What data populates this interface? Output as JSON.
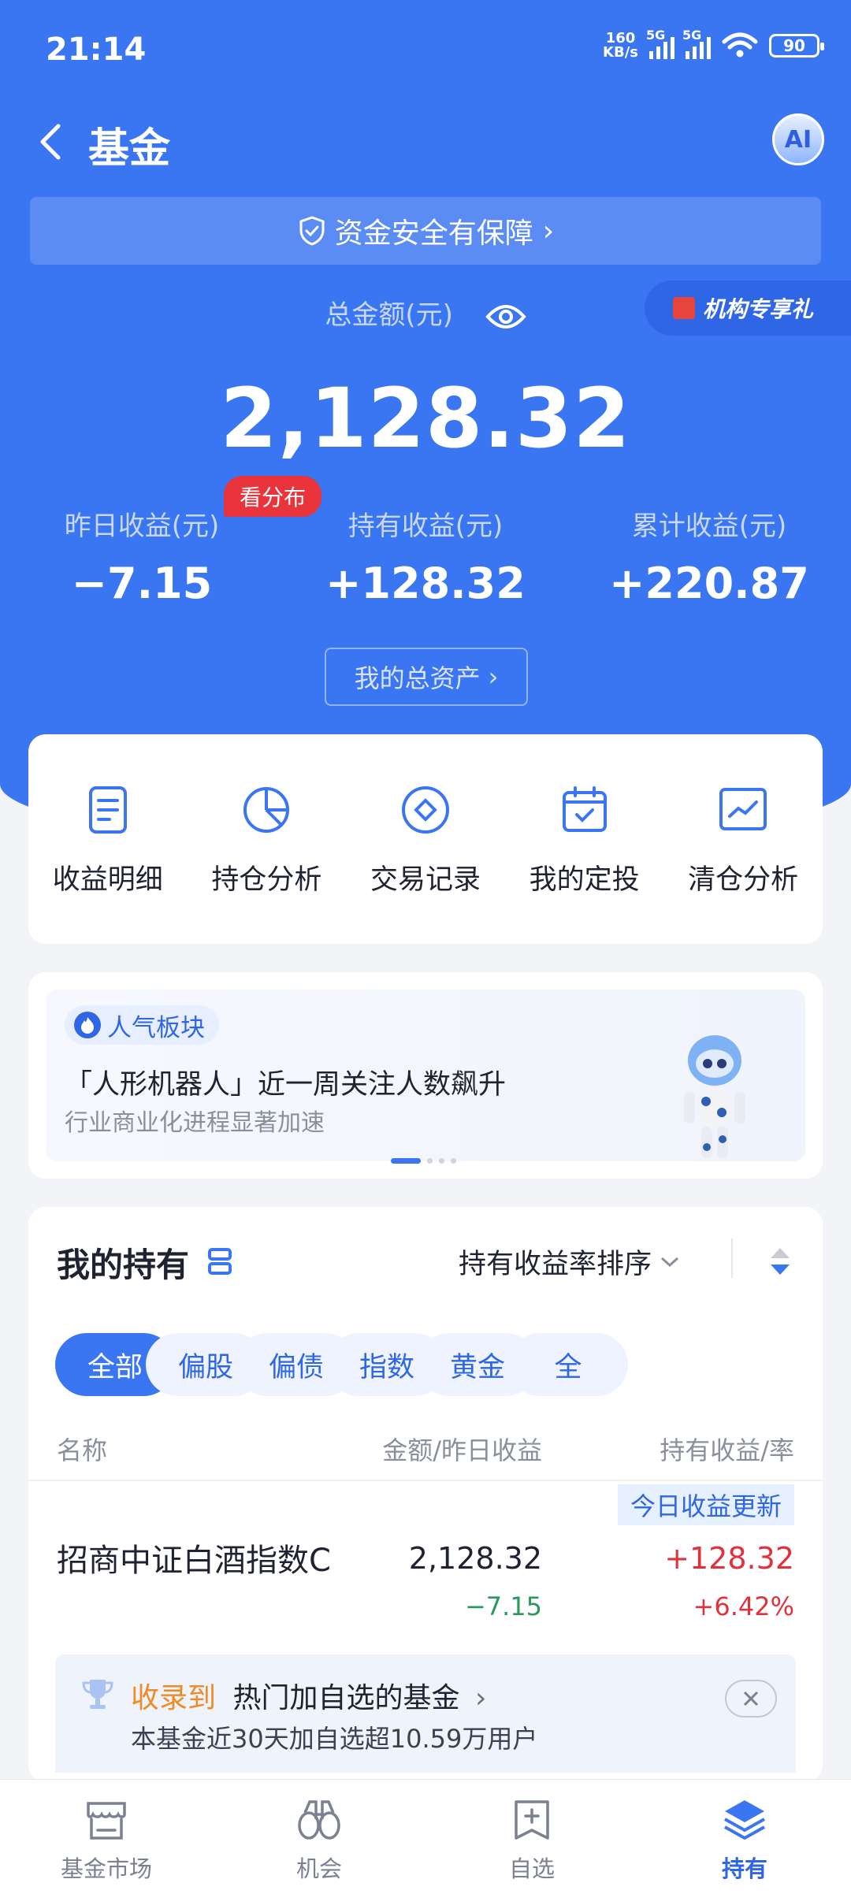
{
  "status_bar": {
    "time": "21:14",
    "net_speed_value": "160",
    "net_speed_unit": "KB/s",
    "signal1_label": "5G",
    "signal2_label": "5G",
    "battery": "90"
  },
  "header": {
    "title": "基金",
    "ai_label": "AI"
  },
  "safety_banner": {
    "text": "资金安全有保障",
    "arrow": "›"
  },
  "institution_badge": {
    "text": "机构专享礼"
  },
  "summary": {
    "total_label": "总金额(元)",
    "total_value": "2,128.32",
    "distribution_badge": "看分布",
    "stats": [
      {
        "label": "昨日收益(元)",
        "value": "−7.15"
      },
      {
        "label": "持有收益(元)",
        "value": "+128.32"
      },
      {
        "label": "累计收益(元)",
        "value": "+220.87"
      }
    ],
    "assets_button": "我的总资产",
    "assets_arrow": "›"
  },
  "tools": [
    {
      "label": "收益明细",
      "icon": "document-icon"
    },
    {
      "label": "持仓分析",
      "icon": "pie-chart-icon"
    },
    {
      "label": "交易记录",
      "icon": "diamond-record-icon"
    },
    {
      "label": "我的定投",
      "icon": "calendar-check-icon"
    },
    {
      "label": "清仓分析",
      "icon": "trend-chart-icon"
    }
  ],
  "promo": {
    "tag": "人气板块",
    "headline": "「人形机器人」近一周关注人数飙升",
    "subtitle": "行业商业化进程显著加速"
  },
  "holdings": {
    "title": "我的持有",
    "sort_label": "持有收益率排序",
    "filters": [
      "全部",
      "偏股",
      "偏债",
      "指数",
      "黄金",
      "全"
    ],
    "columns": {
      "name": "名称",
      "amount": "金额/昨日收益",
      "profit": "持有收益/率"
    },
    "update_badge": "今日收益更新",
    "fund": {
      "name": "招商中证白酒指数C",
      "amount": "2,128.32",
      "yesterday": "−7.15",
      "hold_profit": "+128.32",
      "hold_rate": "+6.42%"
    },
    "recommend": {
      "prefix": "收录到",
      "title": "热门加自选的基金",
      "arrow": "›",
      "detail": "本基金近30天加自选超10.59万用户"
    }
  },
  "tabbar": [
    {
      "label": "基金市场",
      "icon": "market-icon",
      "active": false
    },
    {
      "label": "机会",
      "icon": "binoculars-icon",
      "active": false
    },
    {
      "label": "自选",
      "icon": "add-favorite-icon",
      "active": false
    },
    {
      "label": "持有",
      "icon": "layers-icon",
      "active": true
    }
  ],
  "colors": {
    "brand_blue": "#3b76f2",
    "rise_red": "#e0323c",
    "fall_green": "#2a9a5c",
    "accent_orange": "#f08a24"
  }
}
